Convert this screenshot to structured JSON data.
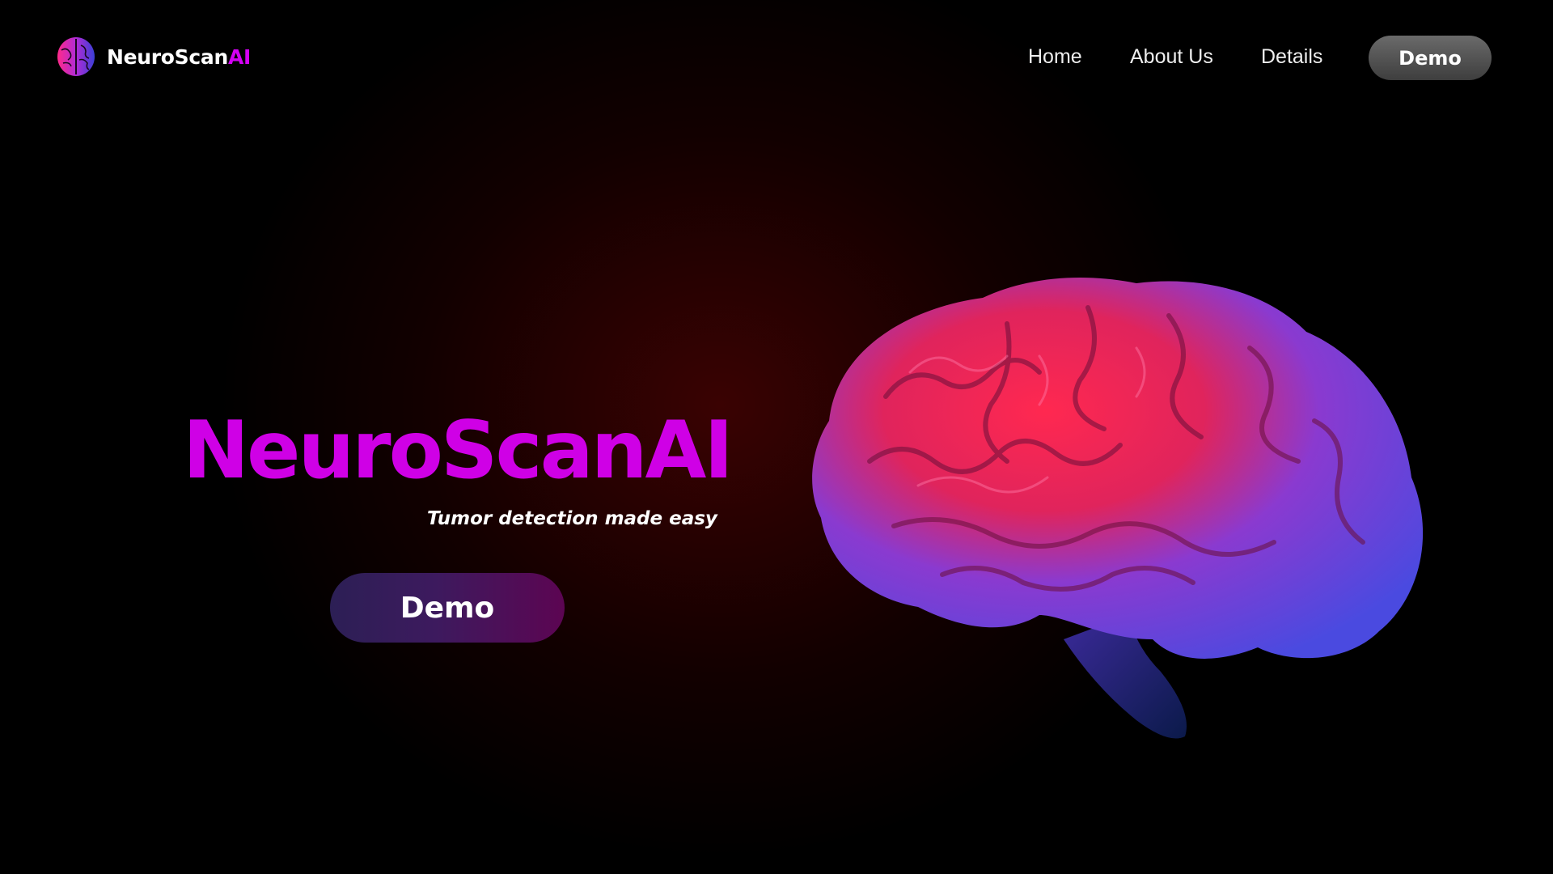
{
  "nav": {
    "logo_icon": "brain-icon",
    "brand_main": "NeuroScan",
    "brand_accent": "AI",
    "links": [
      "Home",
      "About Us",
      "Details"
    ],
    "demo_label": "Demo"
  },
  "hero": {
    "title": "NeuroScanAI",
    "subtitle": "Tumor detection made easy",
    "demo_label": "Demo",
    "image_icon": "brain-illustration"
  },
  "colors": {
    "accent": "#d400f5",
    "title": "#cf00e6",
    "background_glow": "#3a0202"
  }
}
